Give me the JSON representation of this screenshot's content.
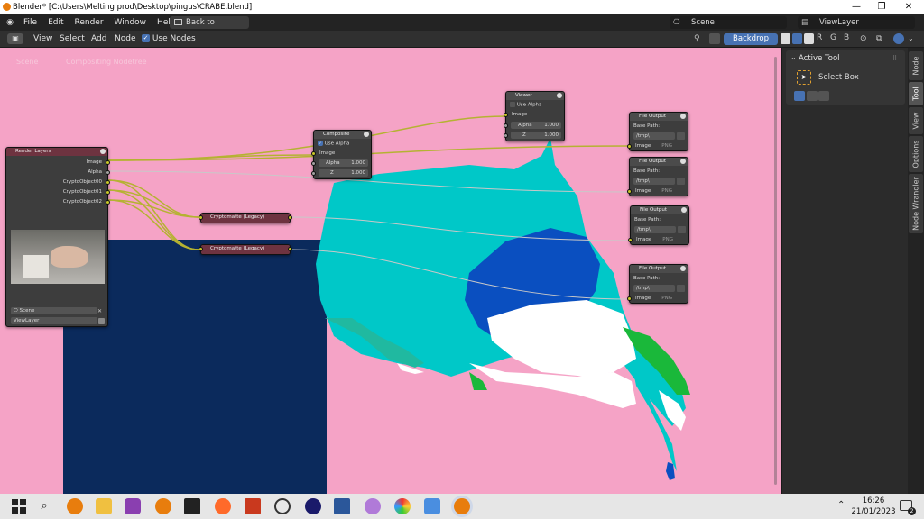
{
  "window": {
    "title": "Blender* [C:\\Users\\Melting prod\\Desktop\\pingus\\CRABE.blend]",
    "minimize": "—",
    "maximize": "❐",
    "close": "✕"
  },
  "menubar": {
    "items": [
      "File",
      "Edit",
      "Render",
      "Window",
      "Help"
    ],
    "back": "Back to Previous",
    "scene": "Scene",
    "view_layer": "ViewLayer"
  },
  "header": {
    "items": [
      "View",
      "Select",
      "Add",
      "Node"
    ],
    "use_nodes": "Use Nodes",
    "backdrop": "Backdrop",
    "channels": [
      "R",
      "G",
      "B"
    ]
  },
  "breadcrumb": {
    "scene": "Scene",
    "tree": "Compositing Nodetree"
  },
  "npanel": {
    "title": "Active Tool",
    "tool": "Select Box"
  },
  "tabs": [
    "Node",
    "Tool",
    "View",
    "Options",
    "Node Wrangler"
  ],
  "nodes": {
    "render_layers": {
      "title": "Render Layers",
      "outputs": [
        "Image",
        "Alpha",
        "CryptoObject00",
        "CryptoObject01",
        "CryptoObject02"
      ],
      "scene": "Scene",
      "layer": "ViewLayer"
    },
    "composite": {
      "title": "Composite",
      "use_alpha": "Use Alpha",
      "image": "Image",
      "alpha": "Alpha",
      "alpha_val": "1.000",
      "z": "Z",
      "z_val": "1.000"
    },
    "viewer": {
      "title": "Viewer",
      "use_alpha": "Use Alpha",
      "image": "Image",
      "alpha": "Alpha",
      "alpha_val": "1.000",
      "z": "Z",
      "z_val": "1.000"
    },
    "crypto1": {
      "title": "Cryptomatte (Legacy)"
    },
    "crypto2": {
      "title": "Cryptomatte (Legacy)"
    },
    "file_outputs": [
      {
        "title": "File Output",
        "base": "Base Path:",
        "path": "/tmp\\",
        "input": "Image",
        "fmt": "PNG"
      },
      {
        "title": "File Output",
        "base": "Base Path:",
        "path": "/tmp\\",
        "input": "Image",
        "fmt": "PNG"
      },
      {
        "title": "File Output",
        "base": "Base Path:",
        "path": "/tmp\\",
        "input": "Image",
        "fmt": "PNG"
      },
      {
        "title": "File Output",
        "base": "Base Path:",
        "path": "/tmp\\",
        "input": "Image",
        "fmt": "PNG"
      }
    ]
  },
  "taskbar": {
    "time": "16:26",
    "date": "21/01/2023",
    "notifications": "2"
  },
  "colors": {
    "bg": "#f5a3c6",
    "navy": "#0b2a5c",
    "cyan": "#00c8c8",
    "blue": "#0a4fc0",
    "green": "#1ab83a"
  }
}
